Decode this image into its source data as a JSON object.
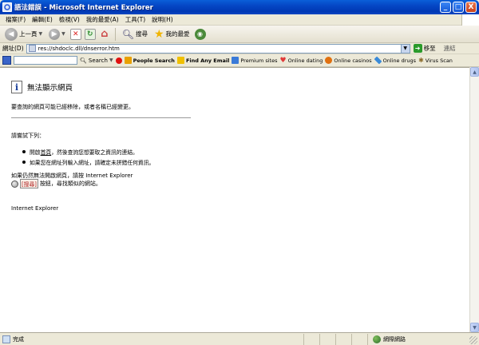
{
  "window": {
    "title": "語法錯誤 - Microsoft Internet Explorer",
    "buttons": {
      "minimize": "_",
      "maximize": "□",
      "close": "X"
    }
  },
  "menu": [
    "檔案(F)",
    "編輯(E)",
    "檢視(V)",
    "我的最愛(A)",
    "工具(T)",
    "說明(H)"
  ],
  "toolbar": {
    "back_label": "上一頁",
    "search_label": "搜尋",
    "favorites_label": "我的最愛"
  },
  "address": {
    "label": "網址(D)",
    "url": "res://shdoclc.dll/dnserror.htm",
    "go_label": "移至",
    "links_label": "連結"
  },
  "search_toolbar": {
    "search_button": "Search",
    "links": [
      {
        "label": "People Search",
        "bold": true,
        "icon": "people-icon",
        "color": "#e8a000"
      },
      {
        "label": "Find Any Email",
        "bold": true,
        "icon": "email-icon",
        "color": "#f0c000"
      },
      {
        "label": "Premium sites",
        "bold": false,
        "icon": "premium-icon",
        "color": "#3a7ad8"
      },
      {
        "label": "Online dating",
        "bold": false,
        "icon": "heart-icon",
        "color": "#e03a3a"
      },
      {
        "label": "Online casinos",
        "bold": false,
        "icon": "casino-icon",
        "color": "#e07010"
      },
      {
        "label": "Online drugs",
        "bold": false,
        "icon": "pill-icon",
        "color": "#3a8ad8"
      },
      {
        "label": "Virus Scan",
        "bold": false,
        "icon": "virus-icon",
        "color": "#8a6a2a"
      }
    ]
  },
  "page": {
    "title": "無法顯示網頁",
    "message": "要查詢的網頁可能已經移除，或者名稱已經變更。",
    "try_label": "請嘗試下列：",
    "tip1_prefix": "開啟",
    "tip1_link": "首頁",
    "tip1_suffix": "，然後查詢您想要取之資訊的連結。",
    "tip2": "如果您在網址列輸入網址，請確定未拼錯任何資訊。",
    "still_text": "如果仍然無法開啟網頁，請按 Internet Explorer",
    "search_button": "[搜尋]",
    "search_suffix": "按鈕，尋找類似的網站。",
    "footer": "Internet Explorer"
  },
  "status": {
    "text": "完成",
    "zone": "網際網路"
  }
}
